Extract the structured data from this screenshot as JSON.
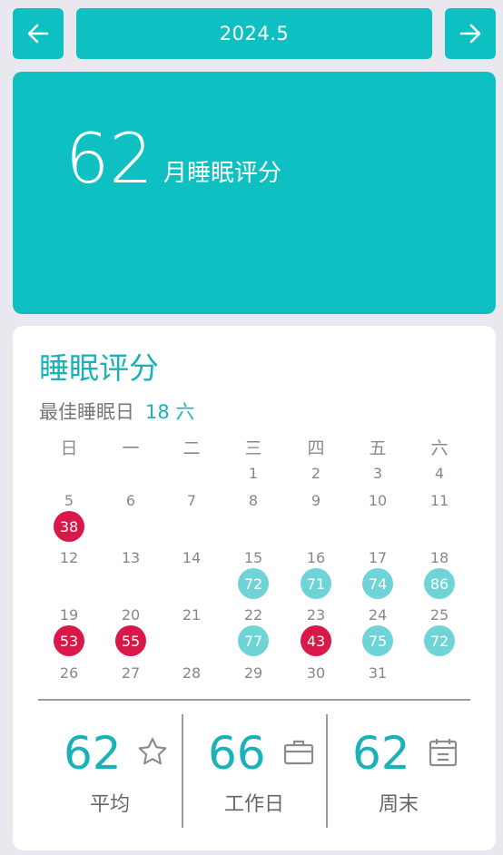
{
  "header": {
    "month": "2024.5"
  },
  "summary": {
    "score": "62",
    "label": "月睡眠评分"
  },
  "panel": {
    "title": "睡眠评分",
    "best_day_label": "最佳睡眠日",
    "best_day_value": "18 六"
  },
  "calendar": {
    "weekdays": [
      "日",
      "一",
      "二",
      "三",
      "四",
      "五",
      "六"
    ],
    "days": [
      "1",
      "2",
      "3",
      "4",
      "5",
      "6",
      "7",
      "8",
      "9",
      "10",
      "11",
      "12",
      "13",
      "14",
      "15",
      "16",
      "17",
      "18",
      "19",
      "20",
      "21",
      "22",
      "23",
      "24",
      "25",
      "26",
      "27",
      "28",
      "29",
      "30",
      "31"
    ],
    "scores": [
      {
        "day": "5",
        "score": "38",
        "level": "bad"
      },
      {
        "day": "15",
        "score": "72",
        "level": "good"
      },
      {
        "day": "16",
        "score": "71",
        "level": "good"
      },
      {
        "day": "17",
        "score": "74",
        "level": "good"
      },
      {
        "day": "18",
        "score": "86",
        "level": "good"
      },
      {
        "day": "19",
        "score": "53",
        "level": "bad"
      },
      {
        "day": "20",
        "score": "55",
        "level": "bad"
      },
      {
        "day": "22",
        "score": "77",
        "level": "good"
      },
      {
        "day": "23",
        "score": "43",
        "level": "bad"
      },
      {
        "day": "24",
        "score": "75",
        "level": "good"
      },
      {
        "day": "25",
        "score": "72",
        "level": "good"
      }
    ],
    "first_weekday_index": 3
  },
  "stats": [
    {
      "value": "62",
      "label": "平均",
      "icon": "star-icon"
    },
    {
      "value": "66",
      "label": "工作日",
      "icon": "briefcase-icon"
    },
    {
      "value": "62",
      "label": "周末",
      "icon": "calendar-icon"
    }
  ],
  "colors": {
    "accent": "#0fc0c3",
    "good": "#6fd4d7",
    "bad": "#d9184a"
  }
}
